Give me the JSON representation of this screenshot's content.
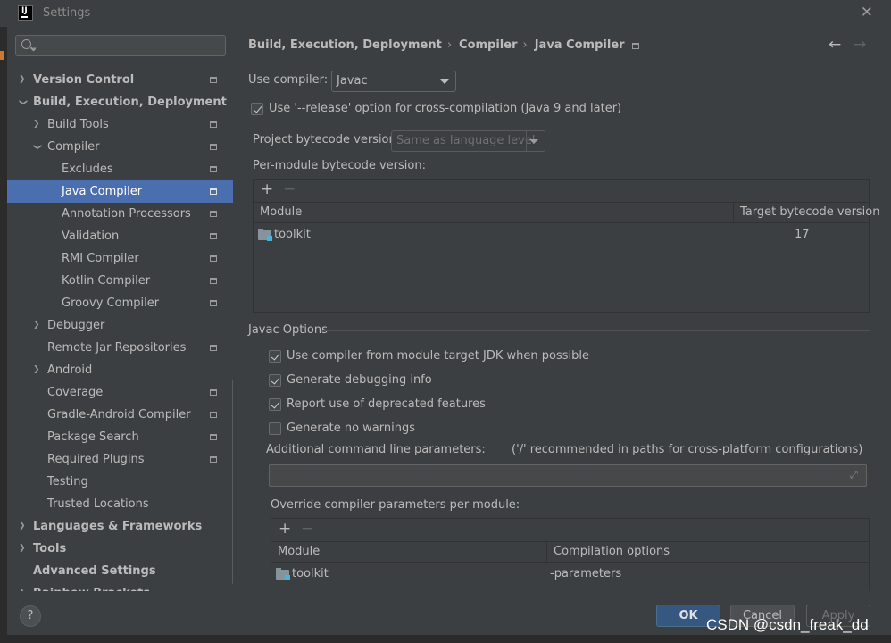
{
  "window": {
    "title": "Settings",
    "close_glyph": "✕"
  },
  "app_icon": {
    "text": "IJ"
  },
  "sidebar": {
    "search": {
      "placeholder": ""
    },
    "tree": [
      {
        "label": "Version Control",
        "level": 0,
        "bold": true,
        "chevron": "collapsed",
        "badge": true
      },
      {
        "label": "Build, Execution, Deployment",
        "level": 0,
        "bold": true,
        "chevron": "expanded",
        "badge": false
      },
      {
        "label": "Build Tools",
        "level": 1,
        "bold": false,
        "chevron": "collapsed",
        "badge": true
      },
      {
        "label": "Compiler",
        "level": 1,
        "bold": false,
        "chevron": "expanded",
        "badge": true
      },
      {
        "label": "Excludes",
        "level": 2,
        "bold": false,
        "chevron": "none",
        "badge": true
      },
      {
        "label": "Java Compiler",
        "level": 2,
        "bold": false,
        "chevron": "none",
        "badge": true,
        "selected": true
      },
      {
        "label": "Annotation Processors",
        "level": 2,
        "bold": false,
        "chevron": "none",
        "badge": true
      },
      {
        "label": "Validation",
        "level": 2,
        "bold": false,
        "chevron": "none",
        "badge": true
      },
      {
        "label": "RMI Compiler",
        "level": 2,
        "bold": false,
        "chevron": "none",
        "badge": true
      },
      {
        "label": "Kotlin Compiler",
        "level": 2,
        "bold": false,
        "chevron": "none",
        "badge": true
      },
      {
        "label": "Groovy Compiler",
        "level": 2,
        "bold": false,
        "chevron": "none",
        "badge": true
      },
      {
        "label": "Debugger",
        "level": 1,
        "bold": false,
        "chevron": "collapsed",
        "badge": false
      },
      {
        "label": "Remote Jar Repositories",
        "level": 1,
        "bold": false,
        "chevron": "none",
        "badge": true
      },
      {
        "label": "Android",
        "level": 1,
        "bold": false,
        "chevron": "collapsed",
        "badge": false
      },
      {
        "label": "Coverage",
        "level": 1,
        "bold": false,
        "chevron": "none",
        "badge": true
      },
      {
        "label": "Gradle-Android Compiler",
        "level": 1,
        "bold": false,
        "chevron": "none",
        "badge": true
      },
      {
        "label": "Package Search",
        "level": 1,
        "bold": false,
        "chevron": "none",
        "badge": true
      },
      {
        "label": "Required Plugins",
        "level": 1,
        "bold": false,
        "chevron": "none",
        "badge": true
      },
      {
        "label": "Testing",
        "level": 1,
        "bold": false,
        "chevron": "none",
        "badge": false
      },
      {
        "label": "Trusted Locations",
        "level": 1,
        "bold": false,
        "chevron": "none",
        "badge": false
      },
      {
        "label": "Languages & Frameworks",
        "level": 0,
        "bold": true,
        "chevron": "collapsed",
        "badge": false
      },
      {
        "label": "Tools",
        "level": 0,
        "bold": true,
        "chevron": "collapsed",
        "badge": false
      },
      {
        "label": "Advanced Settings",
        "level": 0,
        "bold": true,
        "chevron": "none",
        "badge": false
      },
      {
        "label": "Rainbow Brackets",
        "level": 0,
        "bold": true,
        "chevron": "collapsed",
        "badge": false
      }
    ]
  },
  "breadcrumb": {
    "items": [
      "Build, Execution, Deployment",
      "Compiler",
      "Java Compiler"
    ],
    "separator": "›"
  },
  "nav": {
    "back": "←",
    "forward": "→"
  },
  "compiler": {
    "use_compiler_label": "Use compiler:",
    "use_compiler_value": "Javac",
    "release_option_label": "Use '--release' option for cross-compilation (Java 9 and later)",
    "release_option_checked": true,
    "bytecode_label": "Project bytecode version:",
    "bytecode_value": "Same as language level",
    "per_module_label": "Per-module bytecode version:",
    "module_table": {
      "columns": [
        "Module",
        "Target bytecode version"
      ],
      "rows": [
        {
          "module": "toolkit",
          "value": "17"
        }
      ]
    }
  },
  "javac": {
    "section_title": "Javac Options",
    "options": [
      {
        "label": "Use compiler from module target JDK when possible",
        "checked": true
      },
      {
        "label": "Generate debugging info",
        "checked": true
      },
      {
        "label": "Report use of deprecated features",
        "checked": true
      },
      {
        "label": "Generate no warnings",
        "checked": false
      }
    ],
    "additional_params_label": "Additional command line parameters:",
    "additional_params_hint": "('/' recommended in paths for cross-platform configurations)",
    "additional_params_value": "",
    "override_label": "Override compiler parameters per-module:",
    "override_table": {
      "columns": [
        "Module",
        "Compilation options"
      ],
      "rows": [
        {
          "module": "toolkit",
          "options": "-parameters"
        }
      ]
    }
  },
  "toolbar": {
    "add": "+",
    "remove": "−"
  },
  "footer": {
    "help": "?",
    "ok": "OK",
    "cancel": "Cancel",
    "apply": "Apply"
  },
  "watermark": "CSDN @csdn_freak_dd",
  "colors": {
    "accent": "#4b6eaf",
    "ok_button": "#365880",
    "background": "#3c3f41"
  }
}
